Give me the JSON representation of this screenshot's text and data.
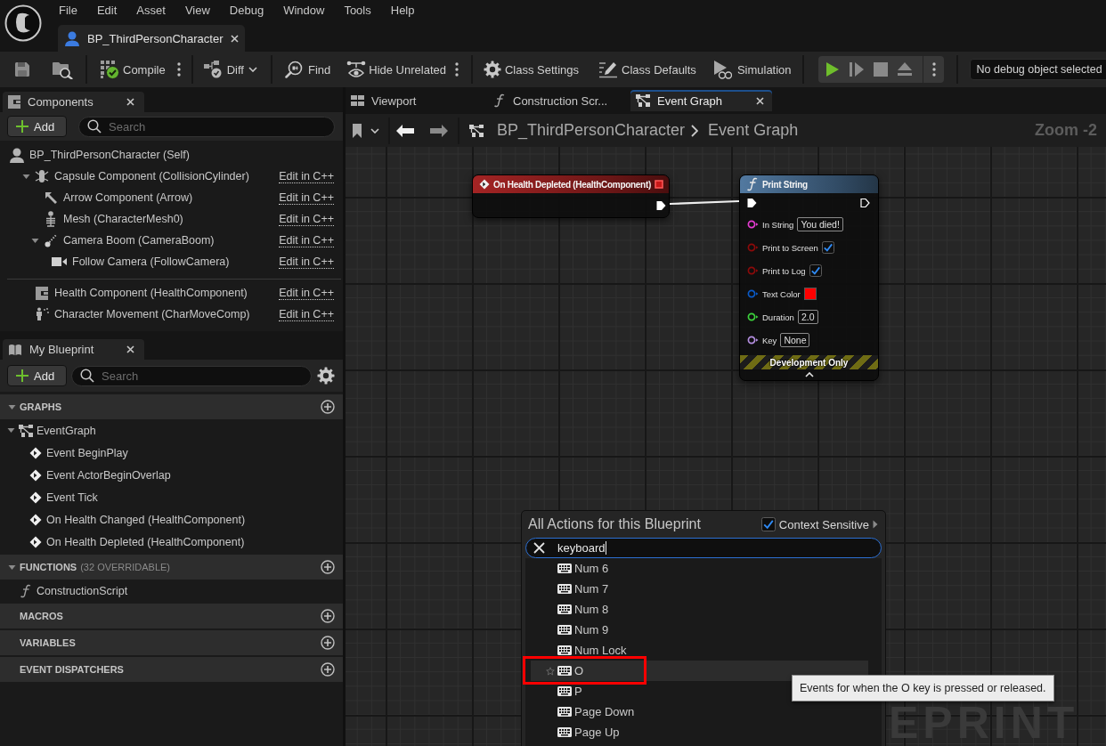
{
  "menu_bar": {
    "items": [
      "File",
      "Edit",
      "Asset",
      "View",
      "Debug",
      "Window",
      "Tools",
      "Help"
    ]
  },
  "document_tabs": [
    {
      "label": "BP_ThirdPersonCharacter",
      "selected": true
    }
  ],
  "toolbar": {
    "compile": "Compile",
    "diff": "Diff",
    "find": "Find",
    "hide_unrelated": "Hide Unrelated",
    "class_settings": "Class Settings",
    "class_defaults": "Class Defaults",
    "simulation": "Simulation",
    "debug_object": "No debug object selected"
  },
  "components_panel": {
    "title": "Components",
    "add_button": "Add",
    "search": {
      "placeholder": "Search"
    },
    "tree": [
      {
        "label": "BP_ThirdPersonCharacter (Self)",
        "kind": "actor",
        "children": [
          {
            "label": "Capsule Component (CollisionCylinder)",
            "kind": "capsule",
            "expanded": true,
            "link": "Edit in C++",
            "children": [
              {
                "label": "Arrow Component (Arrow)",
                "kind": "arrow",
                "link": "Edit in C++"
              },
              {
                "label": "Mesh (CharacterMesh0)",
                "kind": "mesh",
                "link": "Edit in C++"
              },
              {
                "label": "Camera Boom (CameraBoom)",
                "kind": "boom",
                "expanded": true,
                "link": "Edit in C++",
                "children": [
                  {
                    "label": "Follow Camera (FollowCamera)",
                    "kind": "camera",
                    "link": "Edit in C++"
                  }
                ]
              }
            ]
          }
        ]
      }
    ],
    "other_components": [
      {
        "label": "Health Component (HealthComponent)",
        "kind": "component",
        "link": "Edit in C++"
      },
      {
        "label": "Character Movement (CharMoveComp)",
        "kind": "movement",
        "link": "Edit in C++"
      }
    ]
  },
  "my_blueprint": {
    "title": "My Blueprint",
    "add_button": "Add",
    "search": {
      "placeholder": "Search"
    },
    "sections": [
      {
        "title": "GRAPHS",
        "expanded": true,
        "items": [
          {
            "label": "EventGraph",
            "kind": "graph",
            "expanded": true,
            "children": [
              {
                "label": "Event BeginPlay",
                "kind": "event"
              },
              {
                "label": "Event ActorBeginOverlap",
                "kind": "event"
              },
              {
                "label": "Event Tick",
                "kind": "event"
              },
              {
                "label": "On Health Changed (HealthComponent)",
                "kind": "event"
              },
              {
                "label": "On Health Depleted (HealthComponent)",
                "kind": "event"
              }
            ]
          }
        ]
      },
      {
        "title": "FUNCTIONS",
        "note": "(32 OVERRIDABLE)",
        "expanded": true,
        "items": [
          {
            "label": "ConstructionScript",
            "kind": "function"
          }
        ]
      },
      {
        "title": "MACROS"
      },
      {
        "title": "VARIABLES"
      },
      {
        "title": "EVENT DISPATCHERS"
      }
    ]
  },
  "graph_editor": {
    "tabs": [
      {
        "label": "Viewport",
        "kind": "viewport",
        "selected": false
      },
      {
        "label": "Construction Scr...",
        "kind": "function",
        "selected": false
      },
      {
        "label": "Event Graph",
        "kind": "graph",
        "selected": true
      }
    ],
    "breadcrumb": [
      "BP_ThirdPersonCharacter",
      "Event Graph"
    ],
    "zoom_label": "Zoom -2",
    "corner_label": "EPRINT",
    "nodes": [
      {
        "kind": "event",
        "title": "On Health Depleted (HealthComponent)"
      },
      {
        "kind": "function",
        "title": "Print String",
        "pins": [
          {
            "label": "In String",
            "kind": "text",
            "value": "You died!",
            "color": "#e63cd2"
          },
          {
            "label": "Print to Screen",
            "kind": "bool",
            "checked": true,
            "color": "#8c0a0a"
          },
          {
            "label": "Print to Log",
            "kind": "bool",
            "checked": true,
            "color": "#8c0a0a"
          },
          {
            "label": "Text Color",
            "kind": "swatch",
            "swatch": {
              "color": "#ff0000"
            },
            "color": "#0a5ac8"
          },
          {
            "label": "Duration",
            "kind": "text",
            "value": "2.0",
            "color": "#3cd23c"
          },
          {
            "label": "Key",
            "kind": "text",
            "value": "None",
            "color": "#b48ee0"
          }
        ],
        "footer": "Development Only"
      }
    ],
    "action_menu": {
      "title": "All Actions for this Blueprint",
      "context_sensitive": {
        "label": "Context Sensitive",
        "checked": true
      },
      "search": {
        "value": "keyboard"
      },
      "items": [
        {
          "label": "Num 6",
          "selected": false,
          "annotated": false
        },
        {
          "label": "Num 7",
          "selected": false,
          "annotated": false
        },
        {
          "label": "Num 8",
          "selected": false,
          "annotated": false
        },
        {
          "label": "Num 9",
          "selected": false,
          "annotated": false
        },
        {
          "label": "Num Lock",
          "selected": false,
          "annotated": false
        },
        {
          "label": "O",
          "selected": true,
          "annotated": true
        },
        {
          "label": "P",
          "selected": false,
          "annotated": false
        },
        {
          "label": "Page Down",
          "selected": false,
          "annotated": false
        },
        {
          "label": "Page Up",
          "selected": false,
          "annotated": false
        }
      ]
    },
    "tooltip": "Events for when the O key is pressed or released."
  }
}
